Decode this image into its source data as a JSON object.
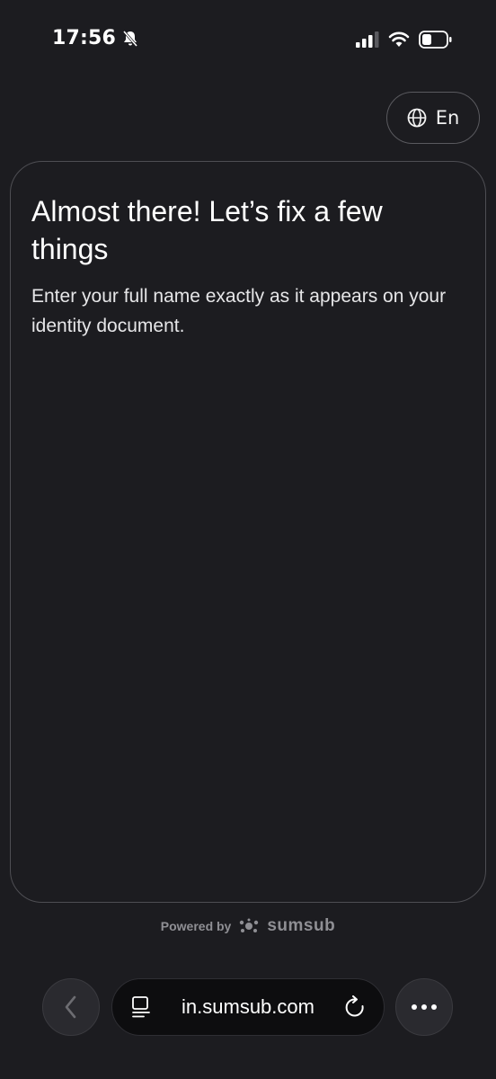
{
  "status_bar": {
    "time": "17:56",
    "icons": [
      "bell-slash-icon",
      "cellular-signal-icon",
      "wifi-icon",
      "battery-icon"
    ]
  },
  "language_button": {
    "label": "En",
    "icon": "globe-icon"
  },
  "card": {
    "title": "Almost there! Let’s fix a few things",
    "subtitle": "Enter your full name exactly as it appears on your identity document."
  },
  "footer": {
    "powered_label": "Powered by",
    "brand": "sumsub"
  },
  "browser": {
    "url": "in.sumsub.com",
    "icons": [
      "back-chevron-icon",
      "reader-icon",
      "reload-icon",
      "more-icon"
    ]
  },
  "colors": {
    "background": "#1c1c20",
    "card_border": "#4e4e53",
    "text_primary": "#ffffff",
    "text_secondary": "#8f8f94"
  }
}
